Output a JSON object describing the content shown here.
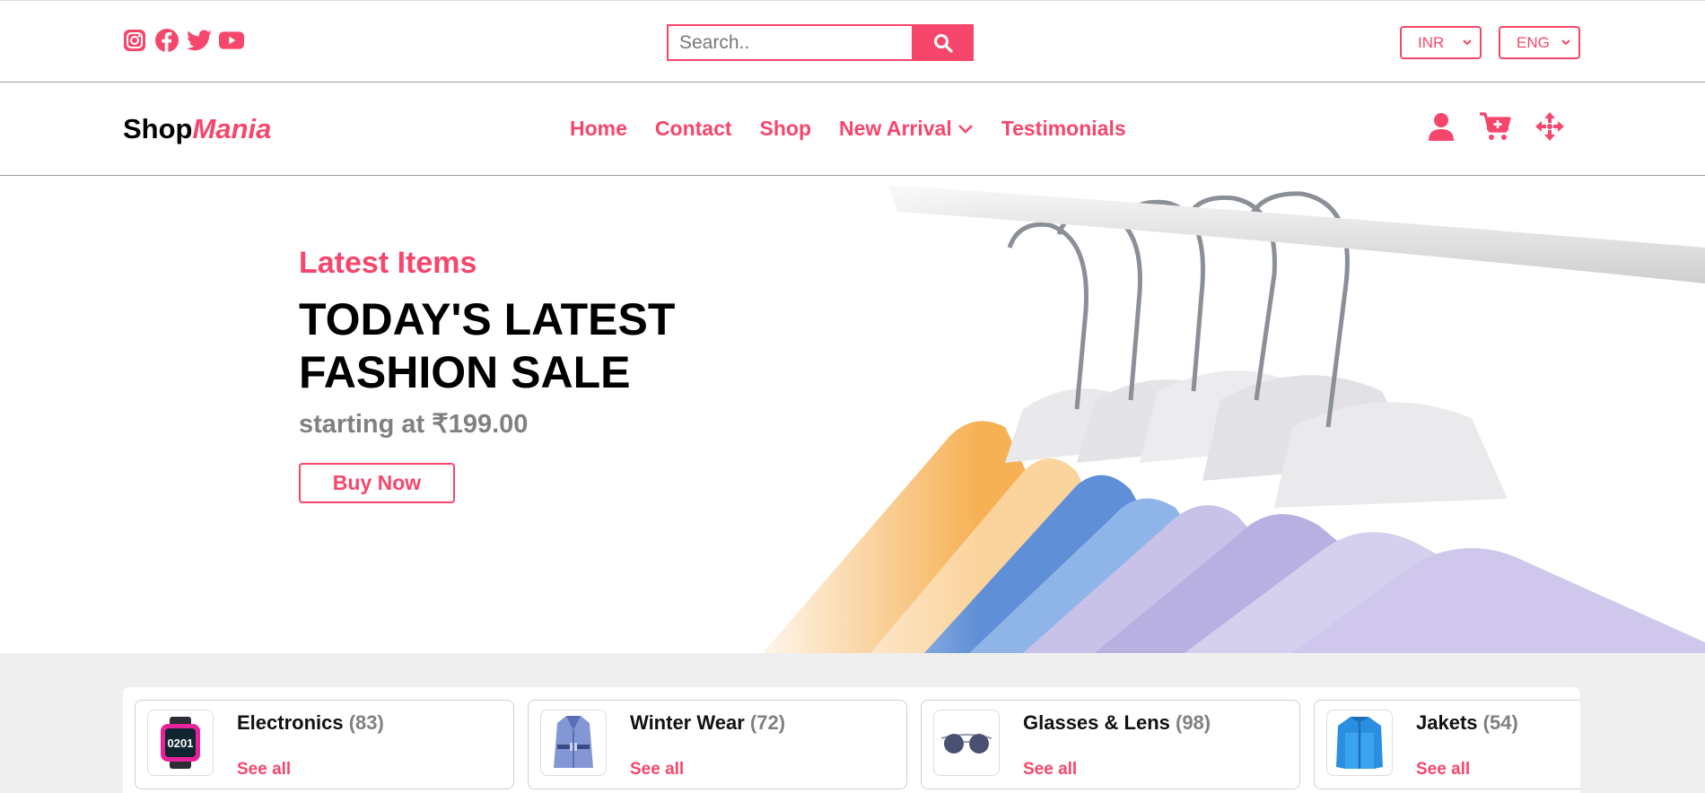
{
  "social": {
    "icons": [
      "instagram-icon",
      "facebook-icon",
      "twitter-icon",
      "youtube-icon"
    ]
  },
  "search": {
    "placeholder": "Search.."
  },
  "currency": {
    "selected": "INR"
  },
  "language": {
    "selected": "ENG"
  },
  "brand": {
    "part1": "Shop",
    "part2": "Mania"
  },
  "nav": {
    "home": "Home",
    "contact": "Contact",
    "shop": "Shop",
    "new_arrival": "New Arrival",
    "testimonials": "Testimonials"
  },
  "hero": {
    "kicker": "Latest Items",
    "headline_line1": "TODAY'S LATEST",
    "headline_line2": "FASHION SALE",
    "price": "starting at ₹199.00",
    "cta": "Buy Now"
  },
  "categories": [
    {
      "name": "Electronics",
      "count": "(83)",
      "link": "See all"
    },
    {
      "name": "Winter Wear",
      "count": "(72)",
      "link": "See all"
    },
    {
      "name": "Glasses & Lens",
      "count": "(98)",
      "link": "See all"
    },
    {
      "name": "Jakets",
      "count": "(54)",
      "link": "See all"
    }
  ],
  "colors": {
    "accent": "#f7466b",
    "band": "#efefef",
    "muted": "#808080"
  }
}
